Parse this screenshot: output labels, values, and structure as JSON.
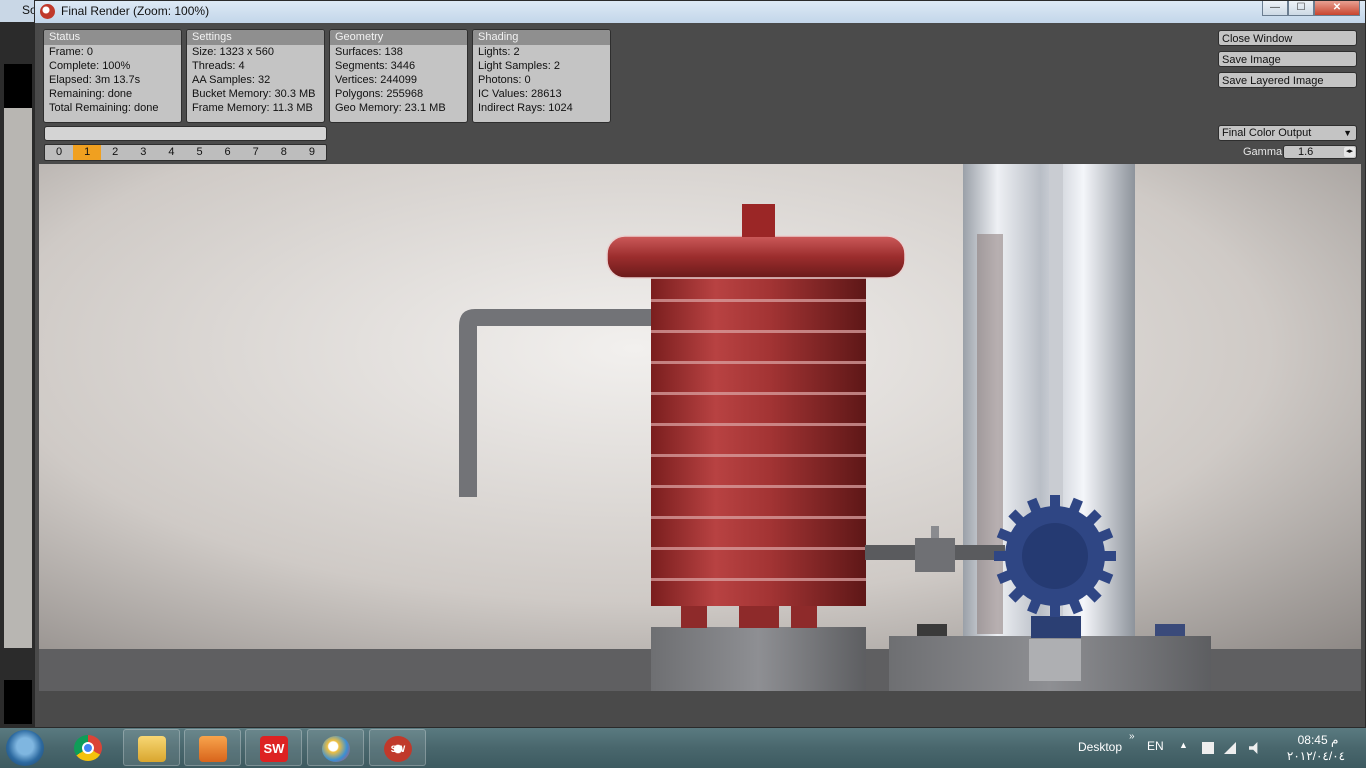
{
  "background_app": {
    "title_fragment": "So"
  },
  "window": {
    "title": "Final Render (Zoom: 100%)",
    "min_label": "—",
    "max_label": "☐",
    "close_label": "✕"
  },
  "panels": {
    "status": {
      "header": "Status",
      "rows": [
        "Frame: 0",
        "Complete: 100%",
        "Elapsed: 3m 13.7s",
        "Remaining: done",
        "Total Remaining: done"
      ]
    },
    "settings": {
      "header": "Settings",
      "rows": [
        "Size: 1323 x 560",
        "Threads: 4",
        "AA Samples: 32",
        "Bucket Memory: 30.3 MB",
        "Frame Memory: 11.3 MB"
      ]
    },
    "geometry": {
      "header": "Geometry",
      "rows": [
        "Surfaces: 138",
        "Segments: 3446",
        "Vertices: 244099",
        "Polygons: 255968",
        "Geo Memory: 23.1 MB"
      ]
    },
    "shading": {
      "header": "Shading",
      "rows": [
        "Lights: 2",
        "Light Samples: 2",
        "Photons: 0",
        "IC Values: 28613",
        "Indirect Rays: 1024"
      ]
    }
  },
  "frames": {
    "labels": [
      "0",
      "1",
      "2",
      "3",
      "4",
      "5",
      "6",
      "7",
      "8",
      "9"
    ],
    "active_index": 1
  },
  "actions": {
    "close_window": "Close Window",
    "save_image": "Save Image",
    "save_layered_image": "Save Layered Image"
  },
  "output": {
    "selected": "Final Color Output",
    "arrow_icon": "chevron-down-icon"
  },
  "gamma": {
    "label": "Gamma",
    "value": "1.6"
  },
  "colors": {
    "accent": "#f0a020",
    "panel_bg": "#c4c4c4",
    "panel_header": "#8f8f8f",
    "window_bg": "#4a4a4a"
  },
  "taskbar": {
    "items": [
      "start-orb-icon",
      "chrome-icon",
      "explorer-icon",
      "media-player-icon",
      "solidworks-icon",
      "paint-icon",
      "solidworks-render-icon"
    ],
    "sw_label": "SW",
    "desktop_label": "Desktop",
    "chevron": "»",
    "language": "EN",
    "tray_up": "▲",
    "time": "08:45 م",
    "date": "٢٠١٢/٠٤/٠٤"
  }
}
